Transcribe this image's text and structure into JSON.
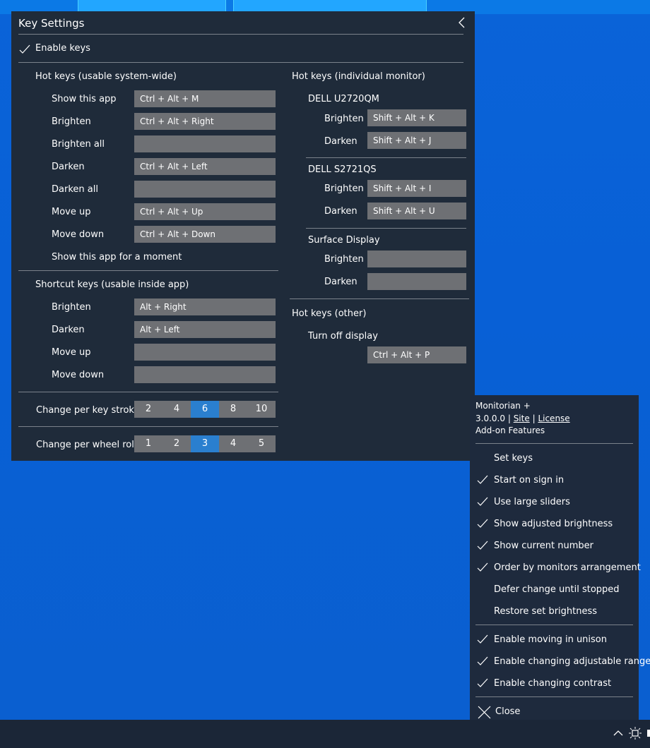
{
  "key_settings": {
    "title": "Key Settings",
    "enable_keys": {
      "label": "Enable keys",
      "checked": true
    },
    "system_wide": {
      "heading": "Hot keys (usable system-wide)",
      "rows": [
        {
          "label": "Show this app",
          "value": "Ctrl + Alt + M"
        },
        {
          "label": "Brighten",
          "value": "Ctrl + Alt + Right"
        },
        {
          "label": "Brighten all",
          "value": ""
        },
        {
          "label": "Darken",
          "value": "Ctrl + Alt + Left"
        },
        {
          "label": "Darken all",
          "value": ""
        },
        {
          "label": "Move up",
          "value": "Ctrl + Alt + Up"
        },
        {
          "label": "Move down",
          "value": "Ctrl + Alt + Down"
        }
      ],
      "moment_label": "Show this app for a moment"
    },
    "inside_app": {
      "heading": "Shortcut keys (usable inside app)",
      "rows": [
        {
          "label": "Brighten",
          "value": "Alt + Right"
        },
        {
          "label": "Darken",
          "value": "Alt + Left"
        },
        {
          "label": "Move up",
          "value": ""
        },
        {
          "label": "Move down",
          "value": ""
        }
      ]
    },
    "key_stroke": {
      "label": "Change per key stroke",
      "options": [
        "2",
        "4",
        "6",
        "8",
        "10"
      ],
      "selected": "6"
    },
    "wheel_roll": {
      "label": "Change per wheel roll",
      "options": [
        "1",
        "2",
        "3",
        "4",
        "5"
      ],
      "selected": "3"
    },
    "individual": {
      "heading": "Hot keys (individual monitor)",
      "monitors": [
        {
          "name": "DELL U2720QM",
          "brighten_label": "Brighten",
          "brighten": "Shift + Alt + K",
          "darken_label": "Darken",
          "darken": "Shift + Alt + J"
        },
        {
          "name": "DELL S2721QS",
          "brighten_label": "Brighten",
          "brighten": "Shift + Alt + I",
          "darken_label": "Darken",
          "darken": "Shift + Alt + U"
        },
        {
          "name": "Surface Display",
          "brighten_label": "Brighten",
          "brighten": "",
          "darken_label": "Darken",
          "darken": ""
        }
      ]
    },
    "other": {
      "heading": "Hot keys (other)",
      "turn_off_label": "Turn off display",
      "turn_off_value": "Ctrl + Alt + P"
    }
  },
  "menu": {
    "app_name": "Monitorian +",
    "version": "3.0.0.0",
    "sep": "|",
    "site": "Site",
    "license": "License",
    "addon": "Add-on Features",
    "items": [
      {
        "label": "Set keys",
        "checked": false
      },
      {
        "label": "Start on sign in",
        "checked": true
      },
      {
        "label": "Use large sliders",
        "checked": true
      },
      {
        "label": "Show adjusted brightness",
        "checked": true
      },
      {
        "label": "Show current number",
        "checked": true
      },
      {
        "label": "Order by monitors arrangement",
        "checked": true
      },
      {
        "label": "Defer change until stopped",
        "checked": false
      },
      {
        "label": "Restore set brightness",
        "checked": false
      }
    ],
    "features": [
      {
        "label": "Enable moving in unison",
        "checked": true
      },
      {
        "label": "Enable changing adjustable range",
        "checked": true
      },
      {
        "label": "Enable changing contrast",
        "checked": true
      }
    ],
    "close": "Close"
  },
  "colors": {
    "accent": "#2a7fcf",
    "panel": "#1f2b3a",
    "field": "#6e7074"
  }
}
